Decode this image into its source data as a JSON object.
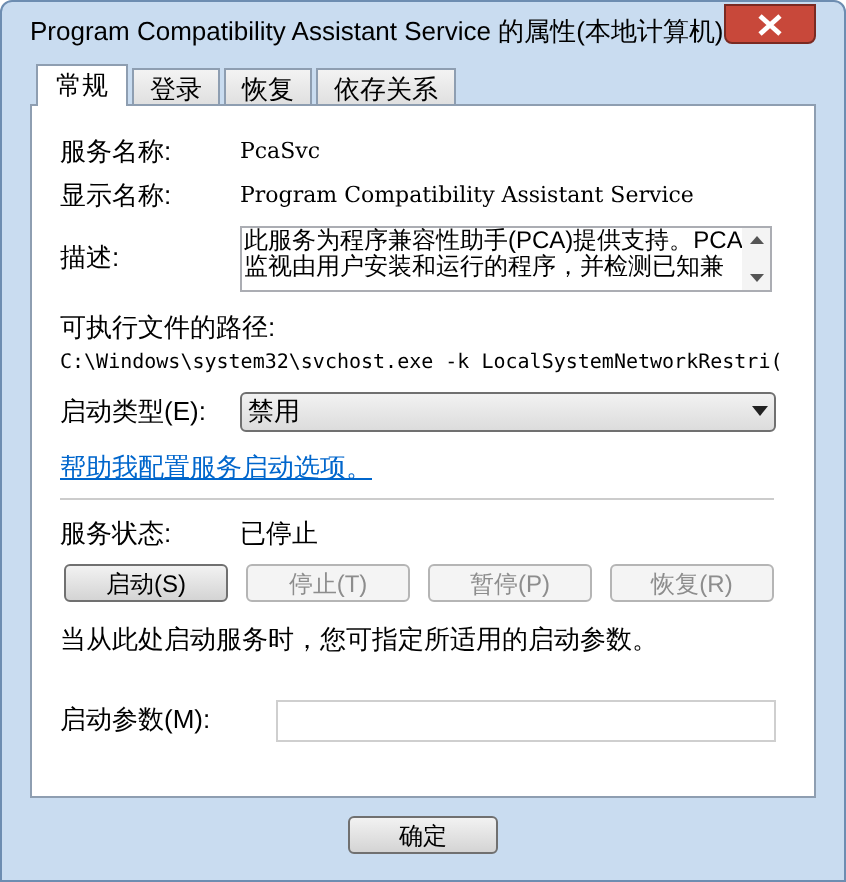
{
  "window": {
    "title": "Program Compatibility Assistant Service 的属性(本地计算机)"
  },
  "tabs": [
    {
      "label": "常规",
      "selected": true
    },
    {
      "label": "登录",
      "selected": false
    },
    {
      "label": "恢复",
      "selected": false
    },
    {
      "label": "依存关系",
      "selected": false
    }
  ],
  "service_name": {
    "label": "服务名称:",
    "value": "PcaSvc"
  },
  "display_name": {
    "label": "显示名称:",
    "value": "Program Compatibility Assistant Service"
  },
  "description": {
    "label": "描述:",
    "value": "此服务为程序兼容性助手(PCA)提供支持。PCA 监视由用户安装和运行的程序，并检测已知兼"
  },
  "path": {
    "label": "可执行文件的路径:",
    "value": "C:\\Windows\\system32\\svchost.exe -k LocalSystemNetworkRestri("
  },
  "startup_type": {
    "label": "启动类型(E):",
    "value": "禁用"
  },
  "help_link": "帮助我配置服务启动选项。",
  "service_status": {
    "label": "服务状态:",
    "value": "已停止"
  },
  "service_buttons": [
    {
      "label": "启动(S)",
      "disabled": false
    },
    {
      "label": "停止(T)",
      "disabled": true
    },
    {
      "label": "暂停(P)",
      "disabled": true
    },
    {
      "label": "恢复(R)",
      "disabled": true
    }
  ],
  "hint": "当从此处启动服务时，您可指定所适用的启动参数。",
  "start_params": {
    "label": "启动参数(M):"
  },
  "dialog_buttons": [
    {
      "label": "确定",
      "disabled": false
    }
  ]
}
